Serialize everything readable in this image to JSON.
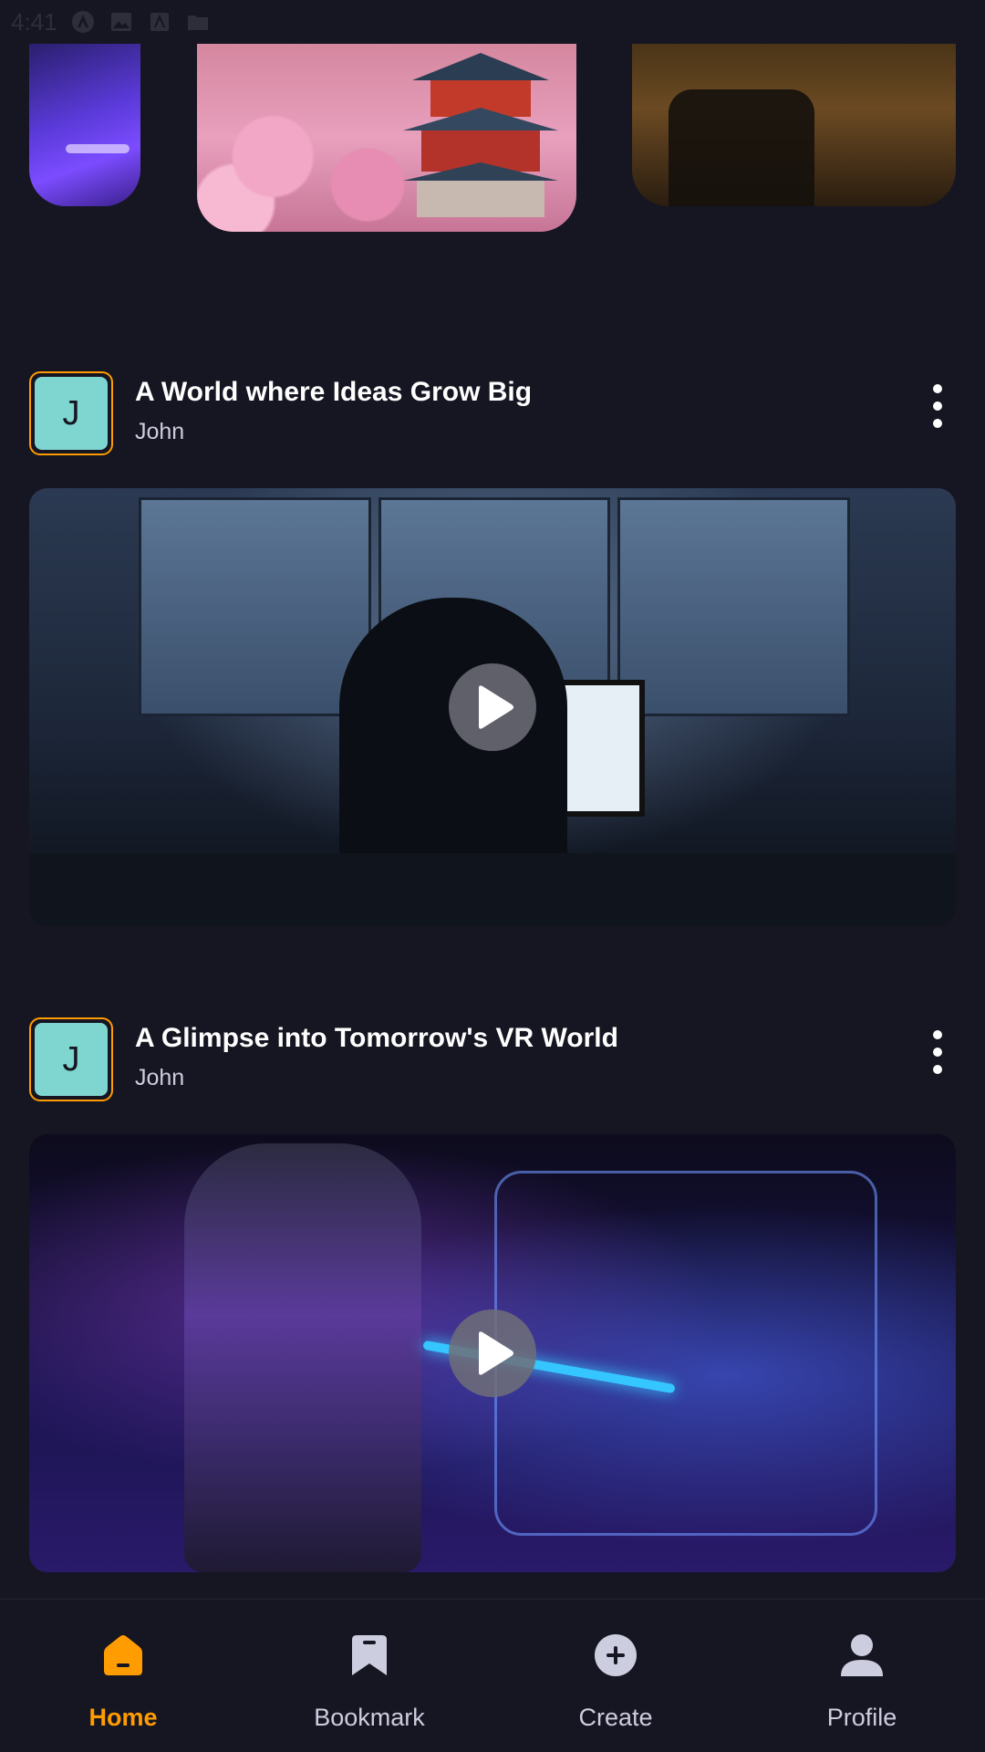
{
  "status_bar": {
    "time": "4:41"
  },
  "carousel": {
    "items": [
      {
        "icon": "vr-purple-image"
      },
      {
        "icon": "cherry-blossom-pagoda-image"
      },
      {
        "icon": "office-chair-image"
      }
    ]
  },
  "posts": [
    {
      "avatar_letter": "J",
      "title": "A World where Ideas Grow Big",
      "author": "John",
      "thumbnail_icon": "hooded-figure-world-map-image"
    },
    {
      "avatar_letter": "J",
      "title": "A Glimpse into Tomorrow's VR World",
      "author": "John",
      "thumbnail_icon": "vr-headset-hologram-image"
    }
  ],
  "bottom_nav": {
    "items": [
      {
        "label": "Home",
        "icon": "home-icon",
        "active": true
      },
      {
        "label": "Bookmark",
        "icon": "bookmark-icon",
        "active": false
      },
      {
        "label": "Create",
        "icon": "plus-circle-icon",
        "active": false
      },
      {
        "label": "Profile",
        "icon": "profile-icon",
        "active": false
      }
    ]
  },
  "colors": {
    "background": "#161622",
    "accent": "#ff9c01",
    "avatar": "#7fd5cf",
    "nav_inactive": "#cdcde0"
  }
}
